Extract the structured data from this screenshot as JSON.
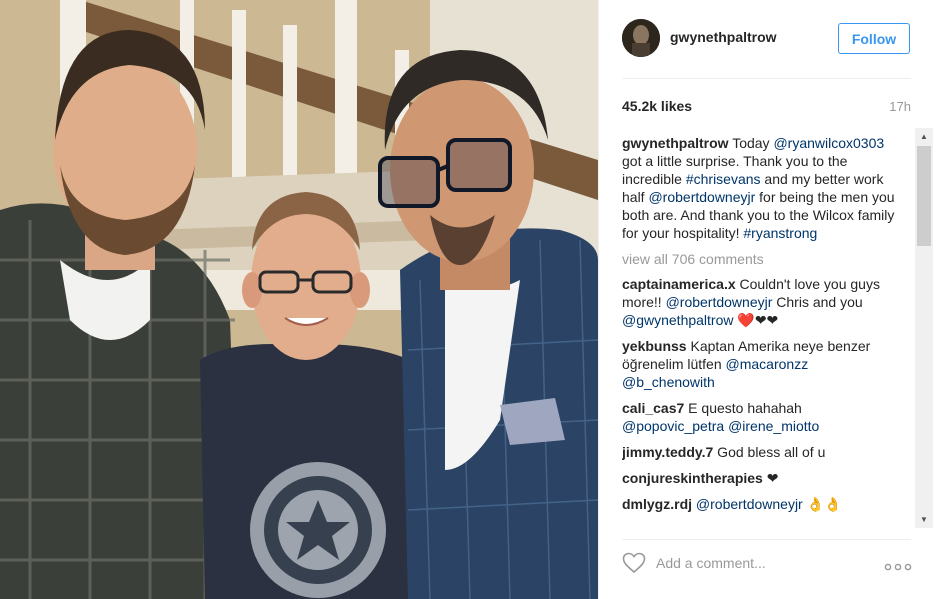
{
  "post": {
    "username": "gwynethpaltrow",
    "follow_label": "Follow",
    "likes": "45.2k likes",
    "time": "17h",
    "view_all": "view all 706 comments",
    "add_comment_placeholder": "Add a comment...",
    "accent_color": "#3897f0",
    "mention_color": "#003569"
  },
  "caption": {
    "user": "gwynethpaltrow",
    "parts": [
      {
        "t": " Today "
      },
      {
        "t": "@ryanwilcox0303",
        "m": true
      },
      {
        "t": " got a little surprise. Thank you to the incredible "
      },
      {
        "t": "#chrisevans",
        "m": true
      },
      {
        "t": " and my better work half "
      },
      {
        "t": "@robertdowneyjr",
        "m": true
      },
      {
        "t": " for being the men you both are. And thank you to the Wilcox family for your hospitality! "
      },
      {
        "t": "#ryanstrong",
        "m": true
      }
    ]
  },
  "comments": [
    {
      "user": "captainamerica.x",
      "parts": [
        {
          "t": " Couldn't love you guys more!! "
        },
        {
          "t": "@robertdowneyjr",
          "m": true
        },
        {
          "t": " Chris and you "
        },
        {
          "t": "@gwynethpaltrow",
          "m": true
        },
        {
          "t": " ❤️❤❤"
        }
      ]
    },
    {
      "user": "yekbunss",
      "parts": [
        {
          "t": " Kaptan Amerika neye benzer öğrenelim lütfen "
        },
        {
          "t": "@macaronzz",
          "m": true
        },
        {
          "t": " "
        },
        {
          "t": "@b_chenowith",
          "m": true
        }
      ]
    },
    {
      "user": "cali_cas7",
      "parts": [
        {
          "t": " E questo hahahah "
        },
        {
          "t": "@popovic_petra",
          "m": true
        },
        {
          "t": " "
        },
        {
          "t": "@irene_miotto",
          "m": true
        }
      ]
    },
    {
      "user": "jimmy.teddy.7",
      "parts": [
        {
          "t": " God bless all of u"
        }
      ]
    },
    {
      "user": "conjureskintherapies",
      "parts": [
        {
          "t": " ❤"
        }
      ]
    },
    {
      "user": "dmlygz.rdj",
      "parts": [
        {
          "t": " "
        },
        {
          "t": "@robertdowneyjr",
          "m": true
        },
        {
          "t": " 👌👌"
        }
      ]
    }
  ]
}
